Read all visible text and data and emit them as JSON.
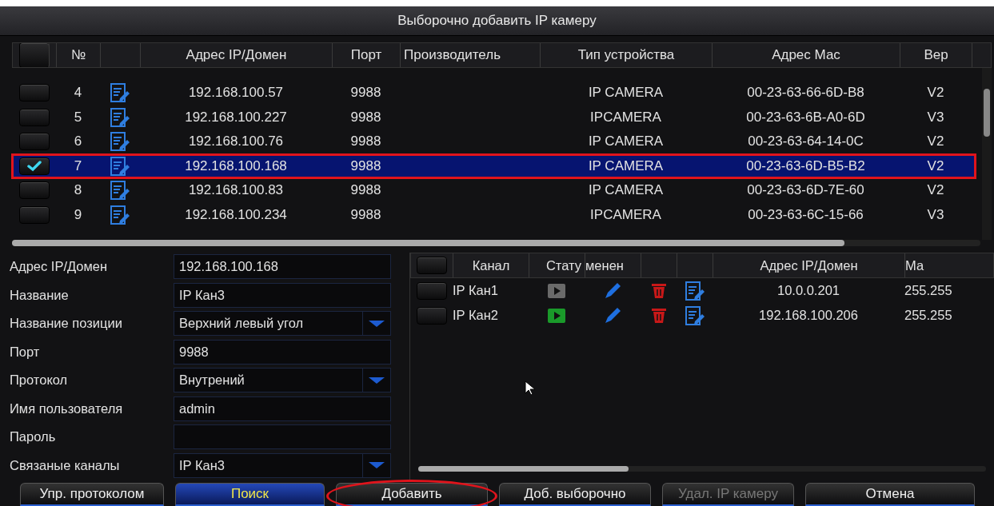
{
  "window": {
    "title": "Выборочно добавить IP камеру"
  },
  "device_table": {
    "all_checked": false,
    "columns": [
      "№",
      "Адрес IP/Домен",
      "Порт",
      "Производитель",
      "Тип устройства",
      "Адрес Мас",
      "Вер"
    ],
    "rows": [
      {
        "no": "4",
        "ip": "192.168.100.57",
        "port": "9988",
        "type": "IP CAMERA",
        "mac": "00-23-63-66-6D-B8",
        "version": "V2",
        "checked": false,
        "selected": false
      },
      {
        "no": "5",
        "ip": "192.168.100.227",
        "port": "9988",
        "type": "IPCAMERA",
        "mac": "00-23-63-6B-A0-6D",
        "version": "V3",
        "checked": false,
        "selected": false
      },
      {
        "no": "6",
        "ip": "192.168.100.76",
        "port": "9988",
        "type": "IP CAMERA",
        "mac": "00-23-63-64-14-0C",
        "version": "V2",
        "checked": false,
        "selected": false
      },
      {
        "no": "7",
        "ip": "192.168.100.168",
        "port": "9988",
        "type": "IP CAMERA",
        "mac": "00-23-63-6D-B5-B2",
        "version": "V2",
        "checked": true,
        "selected": true
      },
      {
        "no": "8",
        "ip": "192.168.100.83",
        "port": "9988",
        "type": "IP CAMERA",
        "mac": "00-23-63-6D-7E-60",
        "version": "V2",
        "checked": false,
        "selected": false
      },
      {
        "no": "9",
        "ip": "192.168.100.234",
        "port": "9988",
        "type": "IPCAMERA",
        "mac": "00-23-63-6C-15-66",
        "version": "V3",
        "checked": false,
        "selected": false
      }
    ]
  },
  "form": {
    "fields": [
      {
        "label": "Адрес IP/Домен",
        "kind": "text",
        "value": "192.168.100.168"
      },
      {
        "label": "Название",
        "kind": "text",
        "value": "IP Кан3"
      },
      {
        "label": "Название позиции",
        "kind": "select",
        "value": "Верхний левый угол"
      },
      {
        "label": "Порт",
        "kind": "text",
        "value": "9988"
      },
      {
        "label": "Протокол",
        "kind": "select",
        "value": "Внутрений"
      },
      {
        "label": "Имя пользователя",
        "kind": "text",
        "value": "admin"
      },
      {
        "label": "Пароль",
        "kind": "password"
      },
      {
        "label": "Связаные каналы",
        "kind": "select",
        "value": "IP Кан3"
      }
    ]
  },
  "channel_list": {
    "all_checked": false,
    "columns": [
      "Канал",
      "Стату",
      "менен",
      "Адрес IP/Домен",
      "Ма"
    ],
    "rows": [
      {
        "channel": "IP Кан1",
        "online": false,
        "ip": "10.0.0.201",
        "mask": "255.255",
        "checked": false
      },
      {
        "channel": "IP Кан2",
        "online": true,
        "ip": "192.168.100.206",
        "mask": "255.255",
        "checked": false
      }
    ]
  },
  "buttons": [
    {
      "label": "Упр. протоколом",
      "kind": "normal",
      "disabled": false,
      "circled": false
    },
    {
      "label": "Поиск",
      "kind": "primary",
      "disabled": false,
      "circled": false
    },
    {
      "label": "Добавить",
      "kind": "normal",
      "disabled": false,
      "circled": true
    },
    {
      "label": "Доб. выборочно",
      "kind": "normal",
      "disabled": false,
      "circled": false
    },
    {
      "label": "Удал. IP камеру",
      "kind": "normal",
      "disabled": true,
      "circled": false
    },
    {
      "label": "Отмена",
      "kind": "normal",
      "disabled": false,
      "circled": false
    }
  ]
}
